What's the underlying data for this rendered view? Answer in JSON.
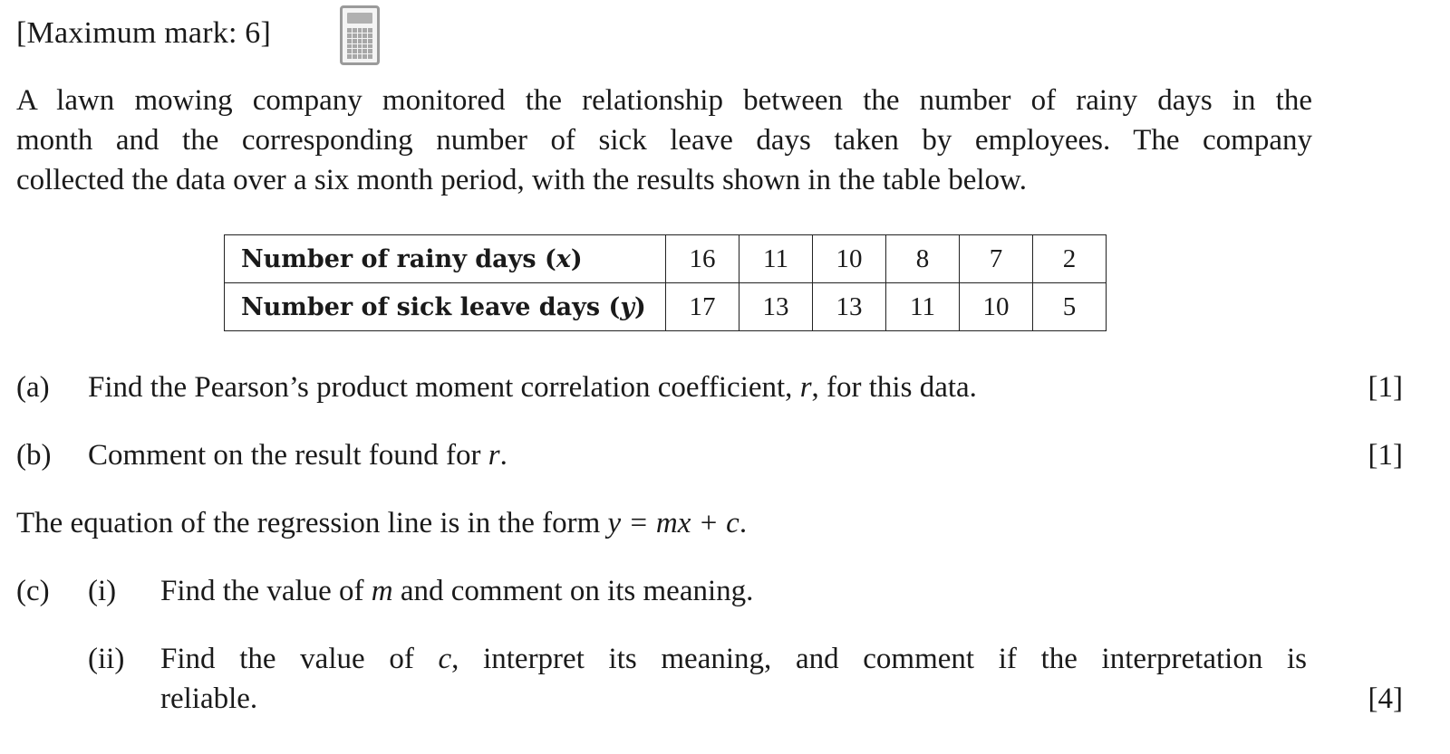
{
  "header": {
    "max_mark": "[Maximum mark: 6]",
    "calculator_icon": "calculator-icon"
  },
  "intro": {
    "line1": "A lawn mowing company monitored the relationship between the number of rainy days in the",
    "line2": "month and the corresponding number of sick leave days taken by employees. The company",
    "line3": "collected the data over a six month period, with the results shown in the table below."
  },
  "table": {
    "rows": [
      {
        "header": "Number of rainy days (x)",
        "values": [
          "16",
          "11",
          "10",
          "8",
          "7",
          "2"
        ]
      },
      {
        "header": "Number of sick leave days (y)",
        "values": [
          "17",
          "13",
          "13",
          "11",
          "10",
          "5"
        ]
      }
    ]
  },
  "questions": {
    "a": {
      "label": "(a)",
      "text_before": "Find the Pearson’s product moment correlation coefficient, ",
      "var": "r",
      "text_after": ", for this data.",
      "mark": "[1]"
    },
    "b": {
      "label": "(b)",
      "text_before": "Comment on the result found for ",
      "var": "r",
      "text_after": ".",
      "mark": "[1]"
    },
    "regression": {
      "text_before": "The equation of the regression line is in the form ",
      "equation": "y = mx + c",
      "text_after": "."
    },
    "c": {
      "label": "(c)",
      "i": {
        "label": "(i)",
        "text_before": "Find the value of ",
        "var": "m",
        "text_after": " and comment on its meaning."
      },
      "ii": {
        "label": "(ii)",
        "line1_before": "Find the value of ",
        "var": "c",
        "line1_after": ", interpret its meaning, and comment if the interpretation is",
        "line2": "reliable."
      },
      "mark": "[4]"
    }
  }
}
